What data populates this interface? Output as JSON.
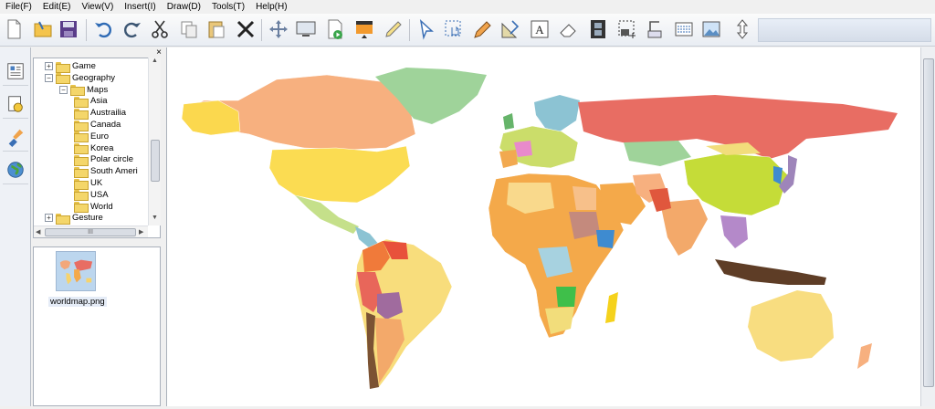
{
  "menu": [
    {
      "label": "File(F)"
    },
    {
      "label": "Edit(E)"
    },
    {
      "label": "View(V)"
    },
    {
      "label": "Insert(I)"
    },
    {
      "label": "Draw(D)"
    },
    {
      "label": "Tools(T)"
    },
    {
      "label": "Help(H)"
    }
  ],
  "toolbar": {
    "icons": [
      "new-file-icon",
      "open-folder-icon",
      "save-icon",
      "undo-icon",
      "redo-icon",
      "cut-icon",
      "copy-icon",
      "paste-icon",
      "delete-icon",
      "move-icon",
      "screen-icon",
      "play-doc-icon",
      "fill-icon",
      "highlighter-icon",
      "pointer-icon",
      "hand-select-icon",
      "pencil-icon",
      "ruler-icon",
      "text-box-icon",
      "eraser-icon",
      "film-icon",
      "capture-icon",
      "scanner-icon",
      "grid-icon",
      "picture-icon",
      "resize-icon"
    ]
  },
  "left_strip": [
    "gallery-icon",
    "clip-icon",
    "paint-icon",
    "globe-icon"
  ],
  "tree": {
    "items": [
      {
        "label": "Game",
        "depth": 1,
        "expander": "+"
      },
      {
        "label": "Geography",
        "depth": 1,
        "expander": "−"
      },
      {
        "label": "Maps",
        "depth": 2,
        "expander": "−"
      },
      {
        "label": "Asia",
        "depth": 3
      },
      {
        "label": "Austrailia",
        "depth": 3
      },
      {
        "label": "Canada",
        "depth": 3
      },
      {
        "label": "Euro",
        "depth": 3
      },
      {
        "label": "Korea",
        "depth": 3
      },
      {
        "label": "Polar circle",
        "depth": 3
      },
      {
        "label": "South Ameri",
        "depth": 3
      },
      {
        "label": "UK",
        "depth": 3
      },
      {
        "label": "USA",
        "depth": 3
      },
      {
        "label": "World",
        "depth": 3
      },
      {
        "label": "Gesture",
        "depth": 1,
        "expander": "+"
      }
    ]
  },
  "panel": {
    "close": "×",
    "hscroll_grip": "III"
  },
  "file": {
    "name": "worldmap.png"
  },
  "colors": {
    "ocean": "#ffffff",
    "northamerica": "#f7b07f",
    "greenland": "#9fd39a",
    "usa": "#fbdc52",
    "russia": "#e86d63",
    "southamerica": "#f8dd7c",
    "africa": "#f4a94a",
    "australia": "#f8dd80",
    "china": "#c5dc38",
    "india": "#f3a96a"
  }
}
